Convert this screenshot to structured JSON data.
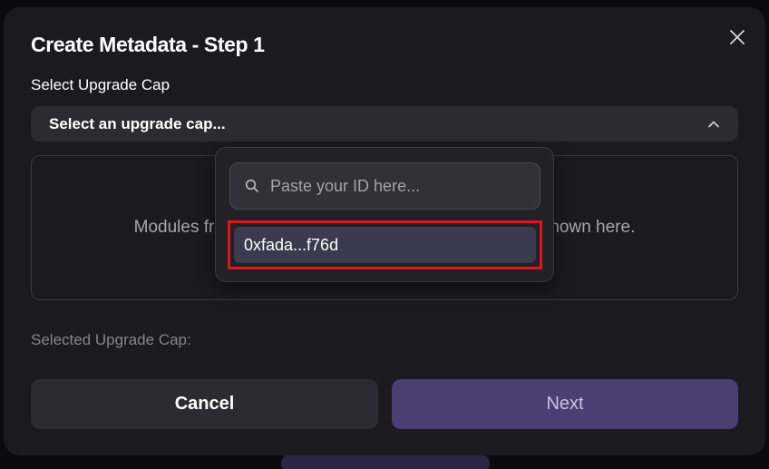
{
  "modal": {
    "title": "Create Metadata - Step 1",
    "close_icon": "close-icon"
  },
  "upgrade_cap": {
    "label": "Select Upgrade Cap",
    "select_text": "Select an upgrade cap...",
    "chevron_icon": "chevron-up-icon"
  },
  "modules": {
    "message_left": "Modules fr",
    "message_right": "hown here."
  },
  "dropdown": {
    "search_placeholder": "Paste your ID here...",
    "search_value": "",
    "search_icon": "search-icon",
    "options": [
      {
        "label": "0xfada...f76d",
        "highlighted": true
      }
    ],
    "highlight_color": "#e0141b"
  },
  "selected": {
    "label": "Selected Upgrade Cap:"
  },
  "actions": {
    "cancel_label": "Cancel",
    "next_label": "Next"
  },
  "colors": {
    "modal_bg": "#1b1a1f",
    "field_bg": "#2c2b31",
    "next_button_bg": "#4a3e72",
    "option_bg": "#3c3a4e"
  }
}
